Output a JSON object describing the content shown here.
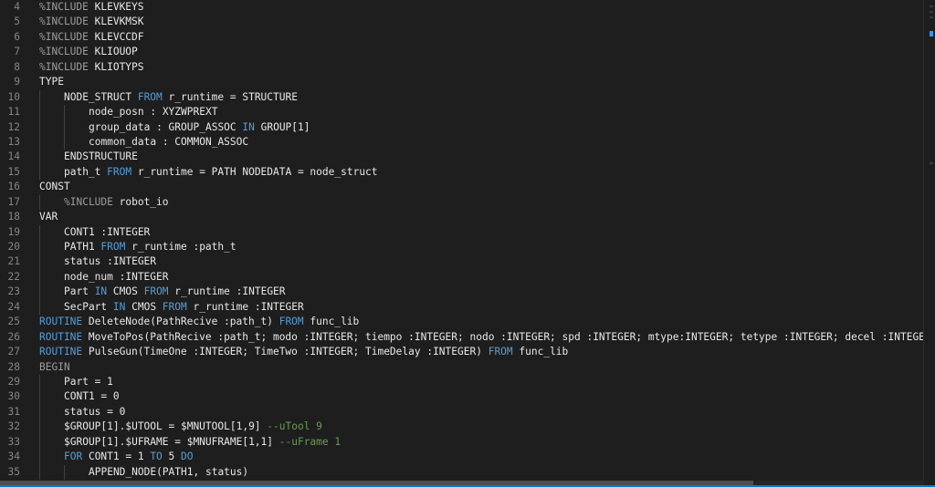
{
  "editor": {
    "lines": [
      {
        "num": "4",
        "indent": 0,
        "tokens": [
          {
            "t": "%INCLUDE ",
            "c": "dim"
          },
          {
            "t": "KLEVKEYS",
            "c": "default"
          }
        ]
      },
      {
        "num": "5",
        "indent": 0,
        "tokens": [
          {
            "t": "%INCLUDE ",
            "c": "dim"
          },
          {
            "t": "KLEVKMSK",
            "c": "default"
          }
        ]
      },
      {
        "num": "6",
        "indent": 0,
        "tokens": [
          {
            "t": "%INCLUDE ",
            "c": "dim"
          },
          {
            "t": "KLEVCCDF",
            "c": "default"
          }
        ]
      },
      {
        "num": "7",
        "indent": 0,
        "tokens": [
          {
            "t": "%INCLUDE ",
            "c": "dim"
          },
          {
            "t": "KLIOUOP",
            "c": "default"
          }
        ]
      },
      {
        "num": "8",
        "indent": 0,
        "tokens": [
          {
            "t": "%INCLUDE ",
            "c": "dim"
          },
          {
            "t": "KLIOTYPS",
            "c": "default"
          }
        ]
      },
      {
        "num": "9",
        "indent": 0,
        "tokens": [
          {
            "t": "TYPE",
            "c": "default"
          }
        ]
      },
      {
        "num": "10",
        "indent": 1,
        "tokens": [
          {
            "t": "NODE_STRUCT ",
            "c": "default"
          },
          {
            "t": "FROM",
            "c": "keyword"
          },
          {
            "t": " r_runtime = STRUCTURE",
            "c": "default"
          }
        ]
      },
      {
        "num": "11",
        "indent": 2,
        "tokens": [
          {
            "t": "node_posn : XYZWPREXT",
            "c": "default"
          }
        ]
      },
      {
        "num": "12",
        "indent": 2,
        "tokens": [
          {
            "t": "group_data : GROUP_ASSOC ",
            "c": "default"
          },
          {
            "t": "IN",
            "c": "keyword"
          },
          {
            "t": " GROUP[1]",
            "c": "default"
          }
        ]
      },
      {
        "num": "13",
        "indent": 2,
        "tokens": [
          {
            "t": "common_data : COMMON_ASSOC",
            "c": "default"
          }
        ]
      },
      {
        "num": "14",
        "indent": 1,
        "tokens": [
          {
            "t": "ENDSTRUCTURE",
            "c": "default"
          }
        ]
      },
      {
        "num": "15",
        "indent": 1,
        "tokens": [
          {
            "t": "path_t ",
            "c": "default"
          },
          {
            "t": "FROM",
            "c": "keyword"
          },
          {
            "t": " r_runtime = PATH NODEDATA = node_struct",
            "c": "default"
          }
        ]
      },
      {
        "num": "16",
        "indent": 0,
        "tokens": [
          {
            "t": "CONST",
            "c": "default"
          }
        ]
      },
      {
        "num": "17",
        "indent": 1,
        "tokens": [
          {
            "t": "%INCLUDE ",
            "c": "dim"
          },
          {
            "t": "robot_io",
            "c": "default"
          }
        ]
      },
      {
        "num": "18",
        "indent": 0,
        "tokens": [
          {
            "t": "VAR",
            "c": "default"
          }
        ]
      },
      {
        "num": "19",
        "indent": 1,
        "tokens": [
          {
            "t": "CONT1 :INTEGER",
            "c": "default"
          }
        ]
      },
      {
        "num": "20",
        "indent": 1,
        "tokens": [
          {
            "t": "PATH1 ",
            "c": "default"
          },
          {
            "t": "FROM",
            "c": "keyword"
          },
          {
            "t": " r_runtime :path_t",
            "c": "default"
          }
        ]
      },
      {
        "num": "21",
        "indent": 1,
        "tokens": [
          {
            "t": "status :INTEGER",
            "c": "default"
          }
        ]
      },
      {
        "num": "22",
        "indent": 1,
        "tokens": [
          {
            "t": "node_num :INTEGER",
            "c": "default"
          }
        ]
      },
      {
        "num": "23",
        "indent": 1,
        "tokens": [
          {
            "t": "Part ",
            "c": "default"
          },
          {
            "t": "IN",
            "c": "keyword"
          },
          {
            "t": " CMOS ",
            "c": "default"
          },
          {
            "t": "FROM",
            "c": "keyword"
          },
          {
            "t": " r_runtime :INTEGER",
            "c": "default"
          }
        ]
      },
      {
        "num": "24",
        "indent": 1,
        "tokens": [
          {
            "t": "SecPart ",
            "c": "default"
          },
          {
            "t": "IN",
            "c": "keyword"
          },
          {
            "t": " CMOS ",
            "c": "default"
          },
          {
            "t": "FROM",
            "c": "keyword"
          },
          {
            "t": " r_runtime :INTEGER",
            "c": "default"
          }
        ]
      },
      {
        "num": "25",
        "indent": 0,
        "tokens": [
          {
            "t": "ROUTINE",
            "c": "keyword"
          },
          {
            "t": " DeleteNode(PathRecive :path_t) ",
            "c": "default"
          },
          {
            "t": "FROM",
            "c": "keyword"
          },
          {
            "t": " func_lib",
            "c": "default"
          }
        ]
      },
      {
        "num": "26",
        "indent": 0,
        "tokens": [
          {
            "t": "ROUTINE",
            "c": "keyword"
          },
          {
            "t": " MoveToPos(PathRecive :path_t; modo :INTEGER; tiempo :INTEGER; nodo :INTEGER; spd :INTEGER; mtype:INTEGER; tetype :INTEGER; decel :INTEGER",
            "c": "default"
          }
        ]
      },
      {
        "num": "27",
        "indent": 0,
        "tokens": [
          {
            "t": "ROUTINE",
            "c": "keyword"
          },
          {
            "t": " PulseGun(TimeOne :INTEGER; TimeTwo :INTEGER; TimeDelay :INTEGER) ",
            "c": "default"
          },
          {
            "t": "FROM",
            "c": "keyword"
          },
          {
            "t": " func_lib",
            "c": "default"
          }
        ]
      },
      {
        "num": "28",
        "indent": 0,
        "tokens": [
          {
            "t": "BEGIN",
            "c": "dim"
          }
        ]
      },
      {
        "num": "29",
        "indent": 1,
        "tokens": [
          {
            "t": "Part = 1",
            "c": "default"
          }
        ]
      },
      {
        "num": "30",
        "indent": 1,
        "tokens": [
          {
            "t": "CONT1 = 0",
            "c": "default"
          }
        ]
      },
      {
        "num": "31",
        "indent": 1,
        "tokens": [
          {
            "t": "status = 0",
            "c": "default"
          }
        ]
      },
      {
        "num": "32",
        "indent": 1,
        "tokens": [
          {
            "t": "$GROUP[1].$UTOOL = $MNUTOOL[1,9] ",
            "c": "default"
          },
          {
            "t": "--uTool 9",
            "c": "comment"
          }
        ]
      },
      {
        "num": "33",
        "indent": 1,
        "tokens": [
          {
            "t": "$GROUP[1].$UFRAME = $MNUFRAME[1,1] ",
            "c": "default"
          },
          {
            "t": "--uFrame 1",
            "c": "comment"
          }
        ]
      },
      {
        "num": "34",
        "indent": 1,
        "tokens": [
          {
            "t": "FOR",
            "c": "keyword"
          },
          {
            "t": " CONT1 = 1 ",
            "c": "default"
          },
          {
            "t": "TO",
            "c": "keyword"
          },
          {
            "t": " 5 ",
            "c": "default"
          },
          {
            "t": "DO",
            "c": "keyword"
          }
        ]
      },
      {
        "num": "35",
        "indent": 2,
        "tokens": [
          {
            "t": "APPEND_NODE(PATH1, status)",
            "c": "default"
          }
        ]
      }
    ]
  },
  "scroll": {
    "horizontal_position": 0.0
  }
}
